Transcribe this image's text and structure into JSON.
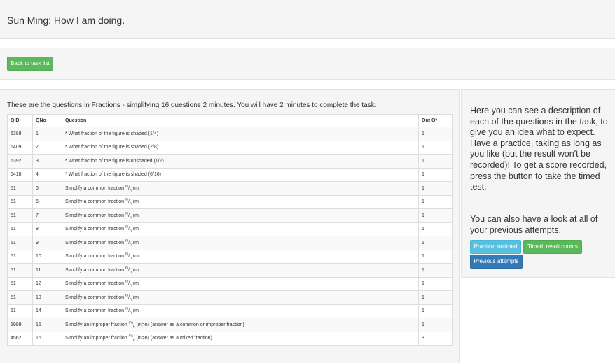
{
  "header": {
    "title": "Sun Ming: How I am doing."
  },
  "nav": {
    "back_label": "Back to task list"
  },
  "main": {
    "intro": "These are the questions in Fractions - simplifying 16 questions 2 minutes. You will have 2 minutes to complete the task.",
    "columns": [
      "QID",
      "QNo",
      "Question",
      "Out Of"
    ],
    "rows": [
      {
        "qid": "6388",
        "qno": "1",
        "question": "* What fraction of the figure is shaded (1/4)",
        "out_of": "1"
      },
      {
        "qid": "6409",
        "qno": "2",
        "question": "* What fraction of the figure is shaded (2/8)",
        "out_of": "1"
      },
      {
        "qid": "6392",
        "qno": "3",
        "question": "* What fraction of the figure is unshaded (1/2)",
        "out_of": "1"
      },
      {
        "qid": "6418",
        "qno": "4",
        "question": "* What fraction of the figure is shaded (6/16)",
        "out_of": "1"
      },
      {
        "qid": "51",
        "qno": "5",
        "question": "Simplify a common fraction",
        "fraction": {
          "num": "m",
          "den": "n",
          "suffix": " (m"
        },
        "out_of": "1"
      },
      {
        "qid": "51",
        "qno": "6",
        "question": "Simplify a common fraction",
        "fraction": {
          "num": "m",
          "den": "n",
          "suffix": " (m"
        },
        "out_of": "1"
      },
      {
        "qid": "51",
        "qno": "7",
        "question": "Simplify a common fraction",
        "fraction": {
          "num": "m",
          "den": "n",
          "suffix": " (m"
        },
        "out_of": "1"
      },
      {
        "qid": "51",
        "qno": "8",
        "question": "Simplify a common fraction",
        "fraction": {
          "num": "m",
          "den": "n",
          "suffix": " (m"
        },
        "out_of": "1"
      },
      {
        "qid": "51",
        "qno": "9",
        "question": "Simplify a common fraction",
        "fraction": {
          "num": "m",
          "den": "n",
          "suffix": " (m"
        },
        "out_of": "1"
      },
      {
        "qid": "51",
        "qno": "10",
        "question": "Simplify a common fraction",
        "fraction": {
          "num": "m",
          "den": "n",
          "suffix": " (m"
        },
        "out_of": "1"
      },
      {
        "qid": "51",
        "qno": "11",
        "question": "Simplify a common fraction",
        "fraction": {
          "num": "m",
          "den": "n",
          "suffix": " (m"
        },
        "out_of": "1"
      },
      {
        "qid": "51",
        "qno": "12",
        "question": "Simplify a common fraction",
        "fraction": {
          "num": "m",
          "den": "n",
          "suffix": " (m"
        },
        "out_of": "1"
      },
      {
        "qid": "51",
        "qno": "13",
        "question": "Simplify a common fraction",
        "fraction": {
          "num": "m",
          "den": "n",
          "suffix": " (m"
        },
        "out_of": "1"
      },
      {
        "qid": "51",
        "qno": "14",
        "question": "Simplify a common fraction",
        "fraction": {
          "num": "m",
          "den": "n",
          "suffix": " (m"
        },
        "out_of": "1"
      },
      {
        "qid": "1999",
        "qno": "15",
        "question": "Simplify an improper fraction",
        "fraction": {
          "num": "m",
          "den": "n",
          "suffix": " (m>n) (answer as a common or improper fraction)"
        },
        "out_of": "1"
      },
      {
        "qid": "4562",
        "qno": "16",
        "question": "Simplify an improper fraction",
        "fraction": {
          "num": "m",
          "den": "n",
          "suffix": " (m>n) (answer as a mixed fraction)"
        },
        "out_of": "3"
      }
    ]
  },
  "side": {
    "description": "Here you can see a description of each of the questions in the task, to give you an idea what to expect. Have a practice, taking as long as you like (but the result won't be recorded)! To get a score recorded, press the button to take the timed test.",
    "previous_text": "You can also have a look at all of your previous attempts.",
    "practice_label": "Practice, untimed",
    "timed_label": "Timed, result counts",
    "previous_label": "Previous attempts"
  },
  "colors": {
    "success": "#5cb85c",
    "info": "#5bc0de",
    "primary": "#337ab7",
    "well": "#f5f5f5"
  }
}
